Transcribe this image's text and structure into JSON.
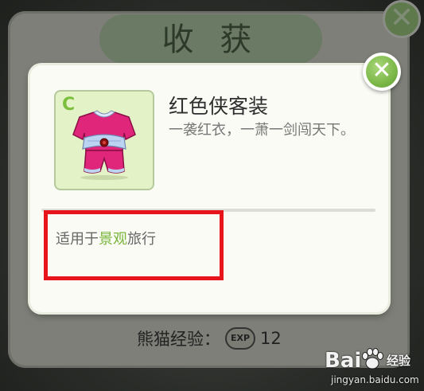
{
  "background": {
    "title": "收 获",
    "close_glyph": "✕",
    "exp_label": "熊猫经验：",
    "exp_badge": "EXP",
    "exp_value": "12"
  },
  "dialog": {
    "grade": "C",
    "item_name": "红色侠客装",
    "item_description": "一袭红衣，一萧一剑闯天下。",
    "usage_prefix": "适用于",
    "usage_highlight": "景观",
    "usage_suffix": "旅行",
    "close_glyph": "✕",
    "icon": "red-outfit-icon"
  },
  "watermark": {
    "brand_left": "Bai",
    "brand_right": "经验",
    "url": "jingyan.baidu.com"
  },
  "colors": {
    "accent_green": "#78b43a",
    "highlight_red": "#e8141b",
    "card_bg": "#e4f2c8"
  }
}
